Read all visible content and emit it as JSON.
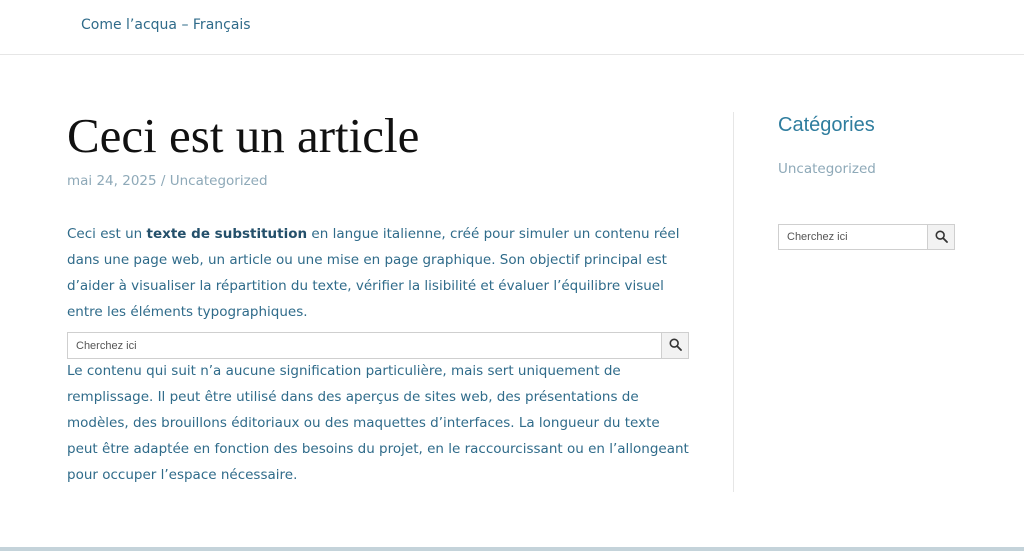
{
  "header": {
    "site_title": "Come l’acqua – Français"
  },
  "article": {
    "title": "Ceci est un article",
    "date": "mai 24, 2025",
    "meta_separator": " / ",
    "category": "Uncategorized",
    "paragraph1": {
      "intro": "Ceci est un ",
      "bold": "texte de substitution",
      "rest": " en langue italienne, créé pour simuler un contenu réel dans une page web, un article ou une mise en page graphique. Son objectif principal est d’aider à visualiser la répartition du texte, vérifier la lisibilité et évaluer l’équilibre visuel entre les éléments typographiques."
    },
    "search": {
      "placeholder": "Cherchez ici"
    },
    "paragraph2": "Le contenu qui suit n’a aucune signification particulière, mais sert uniquement de remplissage. Il peut être utilisé dans des aperçus de sites web, des présentations de modèles, des brouillons éditoriaux ou des maquettes d’interfaces. La longueur du texte peut être adaptée en fonction des besoins du projet, en le raccourcissant ou en l’allongeant pour occuper l’espace nécessaire."
  },
  "sidebar": {
    "heading": "Catégories",
    "categories": [
      "Uncategorized"
    ],
    "search": {
      "placeholder": "Cherchez ici"
    }
  },
  "icons": {
    "search_button": "search-icon"
  },
  "colors": {
    "link": "#2f6b8a",
    "heading_accent": "#2f7d9e",
    "muted": "#8ea9b8",
    "title": "#111111"
  }
}
